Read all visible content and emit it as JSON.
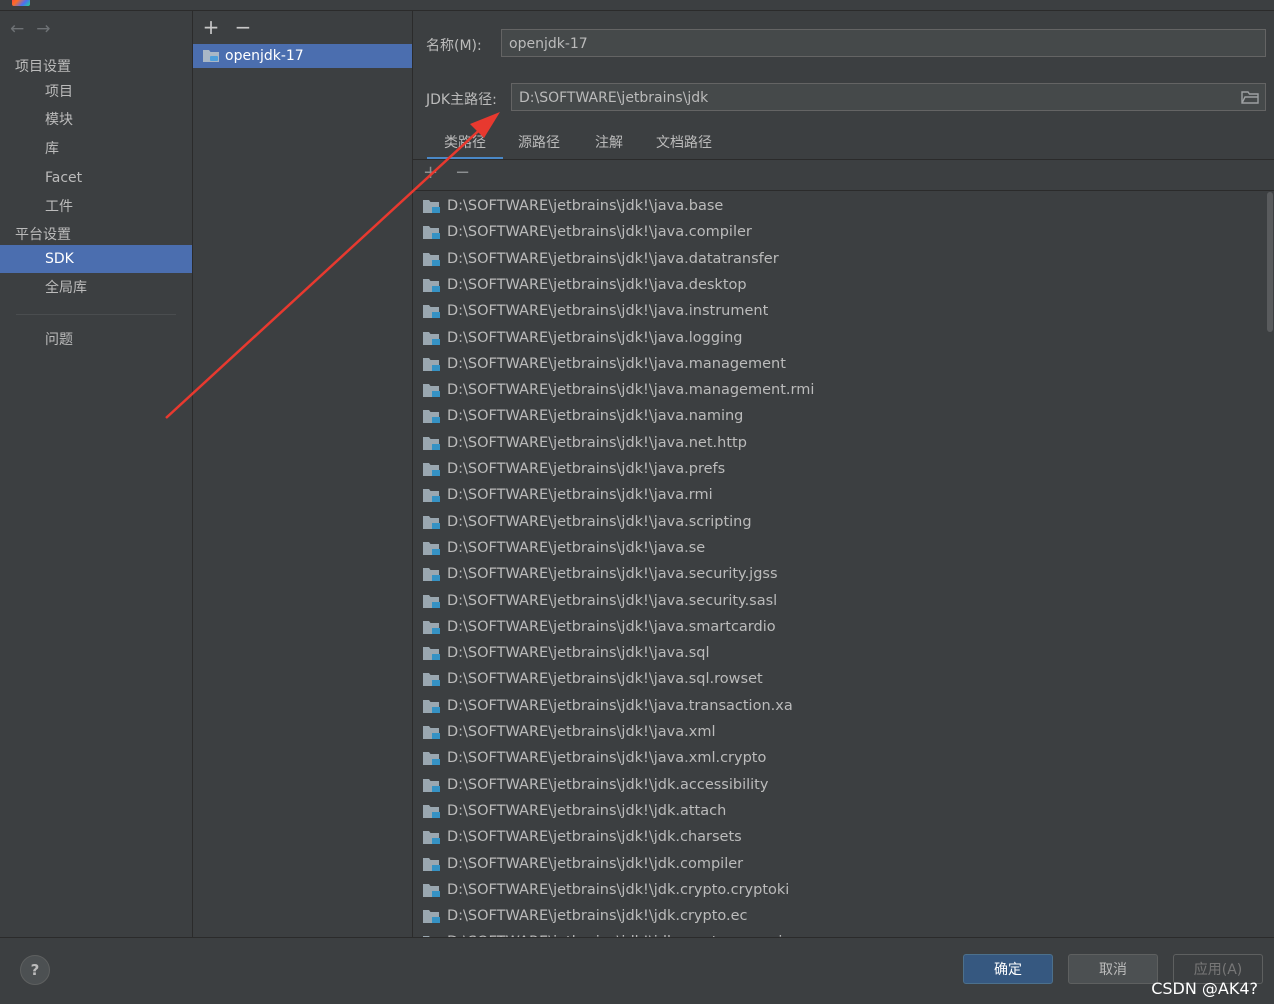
{
  "nav": {
    "group_project": "项目设置",
    "project_items": [
      "项目",
      "模块",
      "库",
      "Facet",
      "工件"
    ],
    "group_platform": "平台设置",
    "platform_items": [
      "SDK",
      "全局库"
    ],
    "selected": "SDK",
    "problems": "问题"
  },
  "sdk_list": {
    "add_label": "+",
    "remove_label": "−",
    "items": [
      "openjdk-17"
    ]
  },
  "form": {
    "name_label": "名称(M):",
    "name_value": "openjdk-17",
    "home_label": "JDK主路径:",
    "home_value": "D:\\SOFTWARE\\jetbrains\\jdk"
  },
  "tabs": [
    "类路径",
    "源路径",
    "注解",
    "文档路径"
  ],
  "active_tab": "类路径",
  "list_toolbar": {
    "add": "+",
    "remove": "−"
  },
  "classpaths": [
    "D:\\SOFTWARE\\jetbrains\\jdk!\\java.base",
    "D:\\SOFTWARE\\jetbrains\\jdk!\\java.compiler",
    "D:\\SOFTWARE\\jetbrains\\jdk!\\java.datatransfer",
    "D:\\SOFTWARE\\jetbrains\\jdk!\\java.desktop",
    "D:\\SOFTWARE\\jetbrains\\jdk!\\java.instrument",
    "D:\\SOFTWARE\\jetbrains\\jdk!\\java.logging",
    "D:\\SOFTWARE\\jetbrains\\jdk!\\java.management",
    "D:\\SOFTWARE\\jetbrains\\jdk!\\java.management.rmi",
    "D:\\SOFTWARE\\jetbrains\\jdk!\\java.naming",
    "D:\\SOFTWARE\\jetbrains\\jdk!\\java.net.http",
    "D:\\SOFTWARE\\jetbrains\\jdk!\\java.prefs",
    "D:\\SOFTWARE\\jetbrains\\jdk!\\java.rmi",
    "D:\\SOFTWARE\\jetbrains\\jdk!\\java.scripting",
    "D:\\SOFTWARE\\jetbrains\\jdk!\\java.se",
    "D:\\SOFTWARE\\jetbrains\\jdk!\\java.security.jgss",
    "D:\\SOFTWARE\\jetbrains\\jdk!\\java.security.sasl",
    "D:\\SOFTWARE\\jetbrains\\jdk!\\java.smartcardio",
    "D:\\SOFTWARE\\jetbrains\\jdk!\\java.sql",
    "D:\\SOFTWARE\\jetbrains\\jdk!\\java.sql.rowset",
    "D:\\SOFTWARE\\jetbrains\\jdk!\\java.transaction.xa",
    "D:\\SOFTWARE\\jetbrains\\jdk!\\java.xml",
    "D:\\SOFTWARE\\jetbrains\\jdk!\\java.xml.crypto",
    "D:\\SOFTWARE\\jetbrains\\jdk!\\jdk.accessibility",
    "D:\\SOFTWARE\\jetbrains\\jdk!\\jdk.attach",
    "D:\\SOFTWARE\\jetbrains\\jdk!\\jdk.charsets",
    "D:\\SOFTWARE\\jetbrains\\jdk!\\jdk.compiler",
    "D:\\SOFTWARE\\jetbrains\\jdk!\\jdk.crypto.cryptoki",
    "D:\\SOFTWARE\\jetbrains\\jdk!\\jdk.crypto.ec",
    "D:\\SOFTWARE\\jetbrains\\jdk!\\jdk.crypto.mscapi"
  ],
  "footer": {
    "help": "?",
    "ok": "确定",
    "cancel": "取消",
    "apply": "应用(A)",
    "watermark": "CSDN @AK4?"
  },
  "colors": {
    "background": "#3c3f41",
    "selection": "#4b6eaf",
    "primary_button": "#365880",
    "annotation_arrow": "#e8392f"
  }
}
